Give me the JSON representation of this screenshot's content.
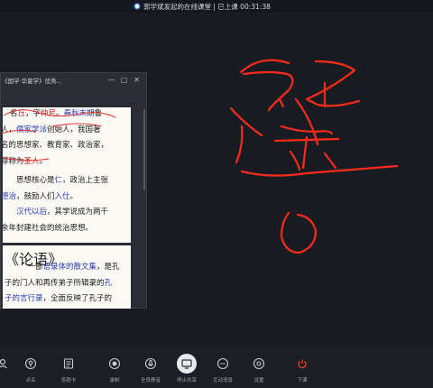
{
  "topbar": {
    "title": "郭学斌发起的在线课堂 | 已上课 00:31:38"
  },
  "doc_window": {
    "title": "《国学·华夏学》优秀...",
    "controls": [
      "—",
      "▢",
      "✕"
    ],
    "page1": {
      "lines": [
        [
          {
            "t": "名丘，字仲尼。春秋末期鲁",
            "c": "mix1"
          }
        ],
        [
          {
            "t": "人，",
            "c": ""
          },
          {
            "t": "儒家学派",
            "c": "blue"
          },
          {
            "t": "创始人，我国著",
            "c": ""
          }
        ],
        [
          {
            "t": "名的思想家、教育家、政治家，",
            "c": ""
          }
        ],
        [
          {
            "t": "尊称为",
            "c": ""
          },
          {
            "t": "圣人",
            "c": "red"
          },
          {
            "t": "。",
            "c": ""
          }
        ],
        [
          {
            "t": "　　思想核心是",
            "c": ""
          },
          {
            "t": "仁",
            "c": "blue"
          },
          {
            "t": "，政治上主张",
            "c": ""
          }
        ],
        [
          {
            "t": "德治",
            "c": "blue"
          },
          {
            "t": "，鼓励人们",
            "c": ""
          },
          {
            "t": "入仕",
            "c": "blue"
          },
          {
            "t": "。",
            "c": ""
          }
        ],
        [
          {
            "t": "　　",
            "c": ""
          },
          {
            "t": "汉代以后",
            "c": "blue"
          },
          {
            "t": "，其学说成为两千",
            "c": ""
          }
        ],
        [
          {
            "t": "余年封建社会的统治思想。",
            "c": ""
          }
        ]
      ],
      "line1_parts": [
        {
          "t": "名",
          "c": ""
        },
        {
          "t": "丘",
          "c": "red"
        },
        {
          "t": "，字",
          "c": ""
        },
        {
          "t": "仲尼",
          "c": "red"
        },
        {
          "t": "。",
          "c": ""
        },
        {
          "t": "春秋末期",
          "c": "blue"
        },
        {
          "t": "鲁",
          "c": ""
        }
      ]
    },
    "page2": {
      "heading": "《论语》",
      "lines": [
        [
          {
            "t": "　　　一部",
            "c": ""
          },
          {
            "t": "语录体的散文集",
            "c": "blue"
          },
          {
            "t": "，是孔",
            "c": ""
          }
        ],
        [
          {
            "t": "子的门人和再传弟子所辑录的",
            "c": ""
          },
          {
            "t": "孔",
            "c": "blue"
          }
        ],
        [
          {
            "t": "子的言行录",
            "c": "blue"
          },
          {
            "t": "，全面反映了孔子的",
            "c": ""
          }
        ]
      ]
    }
  },
  "toolbar": {
    "items": [
      {
        "name": "member-tool",
        "icon": "person-icon",
        "label": ""
      },
      {
        "name": "roll-call-tool",
        "icon": "pin-icon",
        "label": "点名"
      },
      {
        "name": "answer-card-tool",
        "icon": "card-icon",
        "label": "答题卡"
      },
      {
        "name": "record-tool",
        "icon": "record-icon",
        "label": "录制"
      },
      {
        "name": "mute-all-tool",
        "icon": "mute-icon",
        "label": "全员静音"
      },
      {
        "name": "stop-share-tool",
        "icon": "screen-icon",
        "label": "停止共享"
      },
      {
        "name": "interactive-msg-tool",
        "icon": "chat-icon",
        "label": "互动消息"
      },
      {
        "name": "settings-tool",
        "icon": "gear-icon",
        "label": "设置"
      },
      {
        "name": "end-class-tool",
        "icon": "power-icon",
        "label": "下课"
      }
    ]
  },
  "colors": {
    "background": "#171b21",
    "ink": "#ff2a1a",
    "end_class": "#e8432f",
    "highlight_blue": "#2b3db0",
    "highlight_red": "#c81f1f"
  }
}
